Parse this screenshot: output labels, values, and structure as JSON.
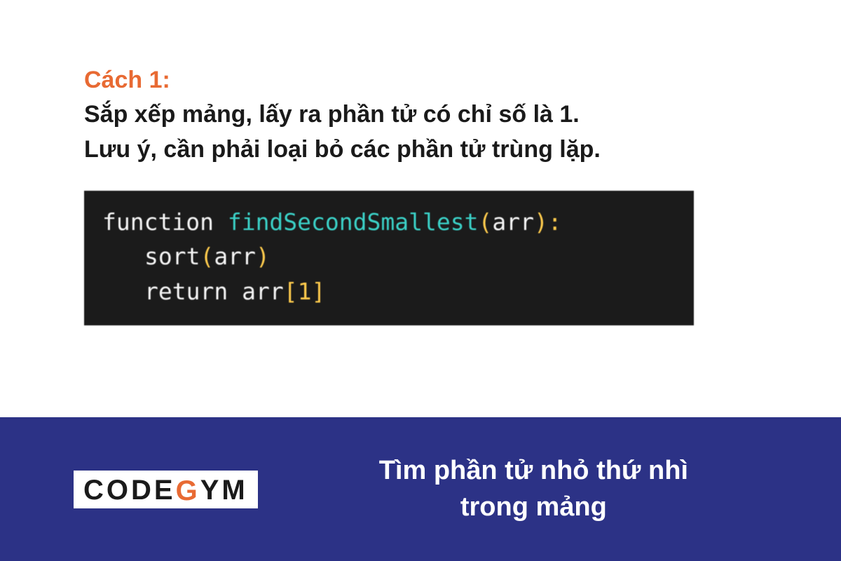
{
  "content": {
    "method_label": "Cách 1:",
    "desc_line1": "Sắp xếp mảng, lấy ra phần tử có chỉ số là 1.",
    "desc_line2": "Lưu ý, cần phải loại bỏ các phần tử trùng lặp."
  },
  "code": {
    "kw_function": "function",
    "fn_name": "findSecondSmallest",
    "p_open": "(",
    "arg": "arr",
    "p_close_colon": "):",
    "call_sort": "sort",
    "p_open2": "(",
    "arg2": "arr",
    "p_close2": ")",
    "kw_return": "return",
    "arr_ref": "arr",
    "br_open": "[",
    "idx": "1",
    "br_close": "]"
  },
  "footer": {
    "logo_pre": "CODE",
    "logo_g": "G",
    "logo_post": "YM",
    "title_line1": "Tìm phần tử nhỏ thứ nhì",
    "title_line2": "trong mảng"
  }
}
